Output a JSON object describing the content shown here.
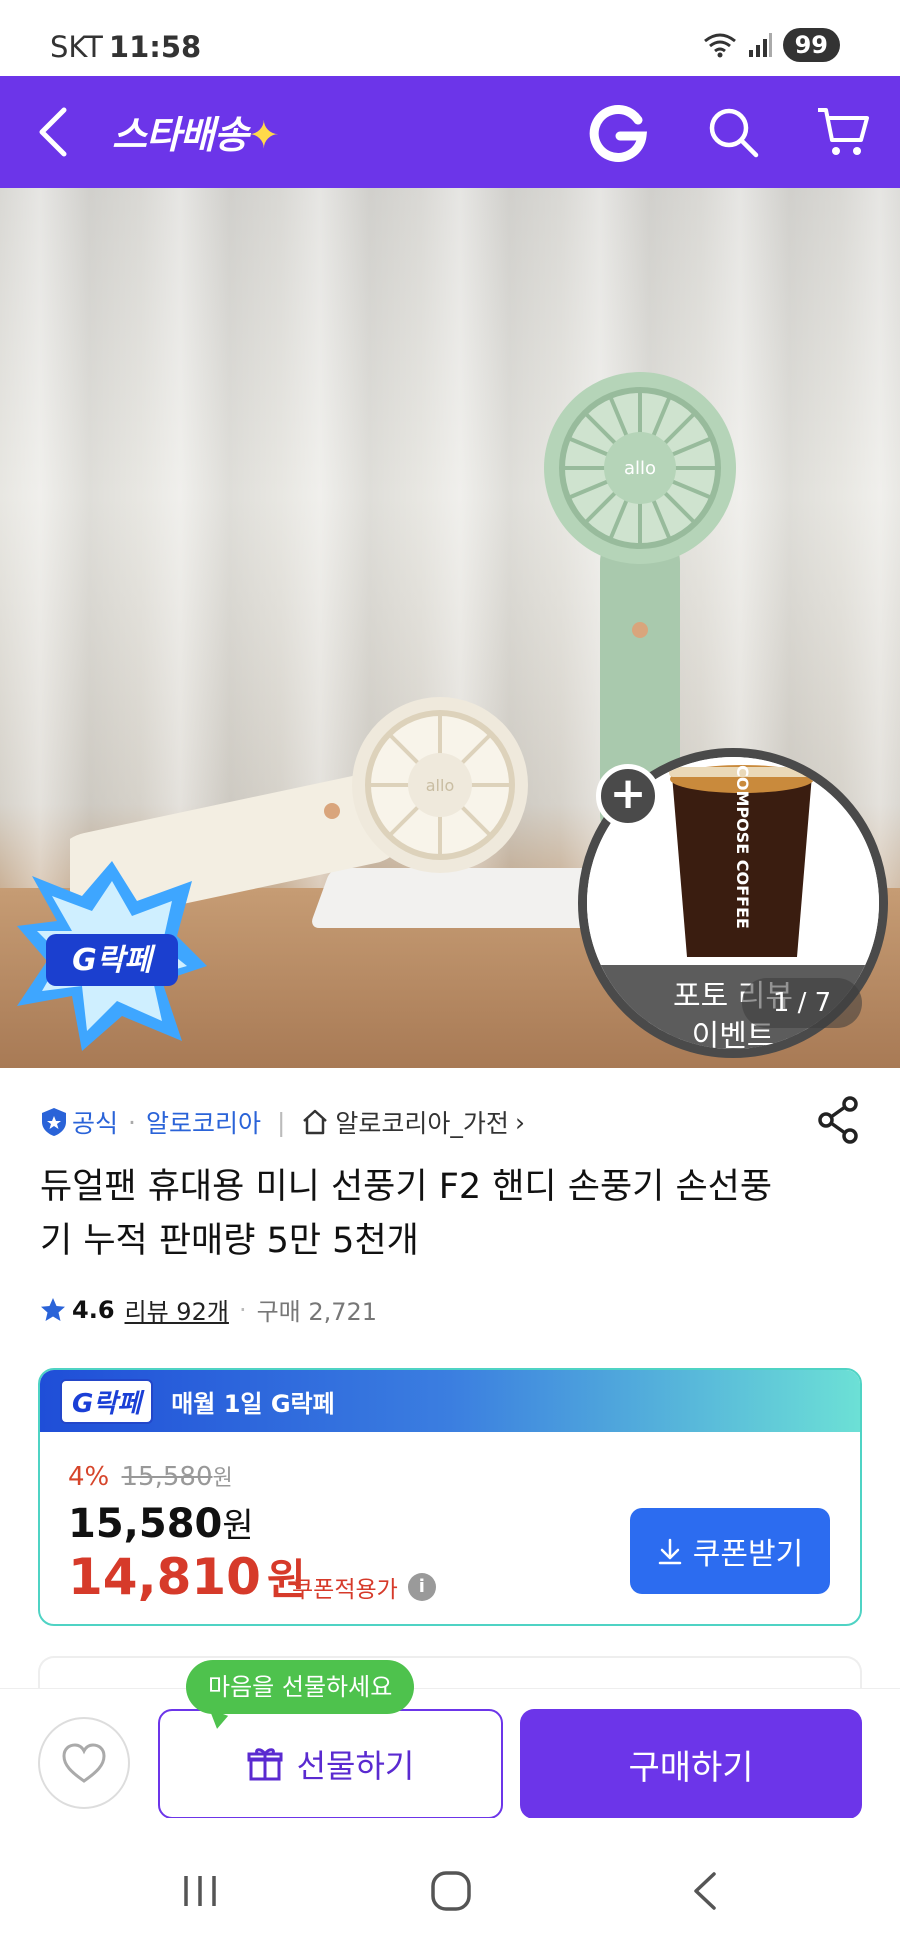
{
  "status_bar": {
    "carrier": "SKT",
    "time": "11:58",
    "battery": "99"
  },
  "app_bar": {
    "brand": "스타배송",
    "brand_spark": "✦"
  },
  "hero": {
    "badge_text": "G락페",
    "promo_caption_line1": "포토 리뷰",
    "promo_caption_line2": "이벤트",
    "promo_plus": "+",
    "cup_text": "COMPOSE COFFEE",
    "fan_logo": "allo",
    "pager": "1 / 7"
  },
  "seller": {
    "official_label": "공식",
    "seller_name": "알로코리아",
    "store_name": "알로코리아_가전",
    "store_chevron": "›"
  },
  "product": {
    "title": "듀얼팬 휴대용 미니 선풍기 F2 핸디 손풍기 손선풍기 누적 판매량 5만 5천개",
    "rating": "4.6",
    "reviews": "리뷰 92개",
    "purchases": "구매 2,721"
  },
  "price_card": {
    "banner_badge": "G락페",
    "banner_label": "매월 1일 G락페",
    "discount_pct": "4%",
    "original_price": "15,580",
    "won": "원",
    "sale_price": "15,580",
    "coupon_price": "14,810",
    "coupon_applied": "쿠폰적용가",
    "coupon_button": "쿠폰받기",
    "info": "i"
  },
  "bottom_bar": {
    "gift_tooltip": "마음을 선물하세요",
    "gift_button": "선물하기",
    "buy_button": "구매하기"
  },
  "colors": {
    "brand_purple": "#6c35e9",
    "price_red": "#d63a2a",
    "coupon_blue": "#2c6cf0",
    "tooltip_green": "#4ec24d"
  }
}
